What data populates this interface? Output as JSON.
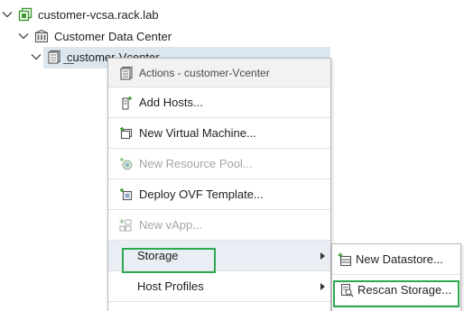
{
  "tree": {
    "vcsa": {
      "label": "customer-vcsa.rack.lab",
      "icon": "vcenter-server-icon"
    },
    "datacenter": {
      "label": "Customer Data Center",
      "icon": "datacenter-icon"
    },
    "vcenter": {
      "label": "customer-Vcenter",
      "icon": "cluster-icon"
    }
  },
  "context_menu": {
    "header": "Actions - customer-Vcenter",
    "items": [
      {
        "label": "Add Hosts...",
        "icon": "add-host-icon",
        "enabled": true
      },
      {
        "label": "New Virtual Machine...",
        "icon": "new-vm-icon",
        "enabled": true
      },
      {
        "label": "New Resource Pool...",
        "icon": "resource-pool-icon",
        "enabled": false
      },
      {
        "label": "Deploy OVF Template...",
        "icon": "deploy-ovf-icon",
        "enabled": true
      },
      {
        "label": "New vApp...",
        "icon": "vapp-icon",
        "enabled": false
      },
      {
        "label": "Storage",
        "has_submenu": true,
        "enabled": true
      },
      {
        "label": "Host Profiles",
        "has_submenu": true,
        "enabled": true
      }
    ]
  },
  "storage_submenu": {
    "items": [
      {
        "label": "New Datastore...",
        "icon": "new-datastore-icon"
      },
      {
        "label": "Rescan Storage...",
        "icon": "rescan-storage-icon"
      }
    ]
  },
  "colors": {
    "highlight_box": "#2ea84f",
    "selected_row": "#dbe6ef",
    "disabled_text": "#a5a5a5"
  }
}
